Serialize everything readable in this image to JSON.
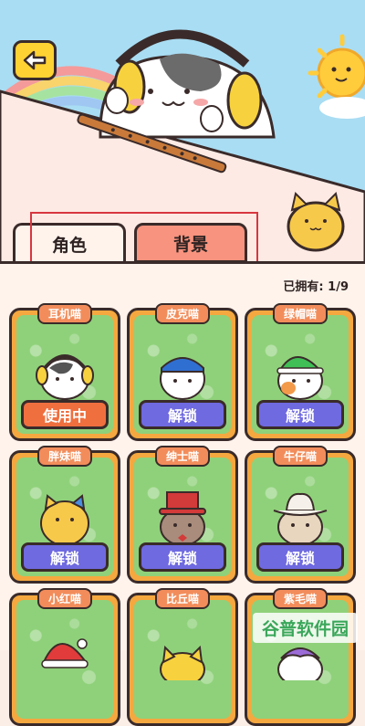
{
  "header": {
    "back_icon": "arrow-left-icon",
    "banner_character": "headphone-cat",
    "prop_item": "bamboo-flute"
  },
  "tabs": [
    {
      "label": "角色",
      "active": true
    },
    {
      "label": "背景",
      "active": false
    }
  ],
  "owned_count": "已拥有: 1/9",
  "cards": [
    {
      "name": "耳机喵",
      "button": "使用中",
      "state": "in-use",
      "cat": "headphone-cat"
    },
    {
      "name": "皮克喵",
      "button": "解锁",
      "state": "locked",
      "cat": "pirate-bandana-cat"
    },
    {
      "name": "绿帽喵",
      "button": "解锁",
      "state": "locked",
      "cat": "green-hat-cat"
    },
    {
      "name": "胖妹喵",
      "button": "解锁",
      "state": "locked",
      "cat": "chubby-bow-cat"
    },
    {
      "name": "绅士喵",
      "button": "解锁",
      "state": "locked",
      "cat": "gentleman-top-hat-cat"
    },
    {
      "name": "牛仔喵",
      "button": "解锁",
      "state": "locked",
      "cat": "cowboy-hat-cat"
    },
    {
      "name": "小红喵",
      "button": "",
      "state": "locked",
      "cat": "santa-hat-cat"
    },
    {
      "name": "比丘喵",
      "button": "",
      "state": "locked",
      "cat": "yellow-cat"
    },
    {
      "name": "紫毛喵",
      "button": "",
      "state": "locked",
      "cat": "purple-hair-cat"
    }
  ],
  "watermark": "谷普软件园",
  "colors": {
    "in_use": "#f06f3f",
    "unlock": "#6f6ae0",
    "card_frame": "#f5a83f",
    "card_bg": "#8fd17a"
  }
}
